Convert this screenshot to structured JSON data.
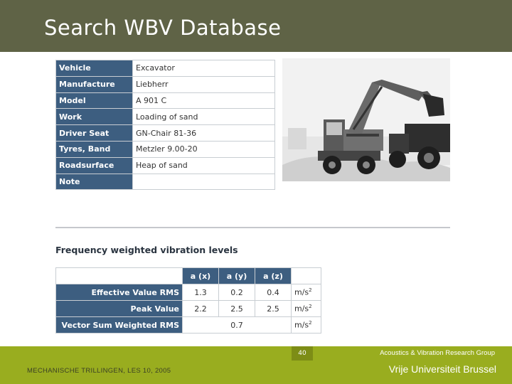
{
  "slide": {
    "title": "Search WBV Database"
  },
  "info_table": {
    "rows": [
      {
        "label": "Vehicle",
        "value": "Excavator"
      },
      {
        "label": "Manufacture",
        "value": "Liebherr"
      },
      {
        "label": "Model",
        "value": "A 901 C"
      },
      {
        "label": "Work",
        "value": "Loading of sand"
      },
      {
        "label": "Driver Seat",
        "value": "GN-Chair 81-36"
      },
      {
        "label": "Tyres, Band",
        "value": "Metzler 9.00-20"
      },
      {
        "label": "Roadsurface",
        "value": "Heap of sand"
      },
      {
        "label": "Note",
        "value": ""
      }
    ]
  },
  "vibration": {
    "heading": "Frequency weighted vibration levels",
    "columns": [
      "a (x)",
      "a (y)",
      "a (z)"
    ],
    "rows": [
      {
        "label": "Effective Value RMS",
        "x": "1.3",
        "y": "0.2",
        "z": "0.4",
        "unit": "m/s",
        "unit_exp": "2"
      },
      {
        "label": "Peak Value",
        "x": "2.2",
        "y": "2.5",
        "z": "2.5",
        "unit": "m/s",
        "unit_exp": "2"
      }
    ],
    "sum_row": {
      "label": "Vector Sum Weighted RMS",
      "value": "0.7",
      "unit": "m/s",
      "unit_exp": "2"
    }
  },
  "footer": {
    "page_number": "40",
    "course": "MECHANISCHE TRILLINGEN, LES 10, 2005",
    "group": "Acoustics & Vibration Research Group",
    "university": "Vrije Universiteit Brussel"
  },
  "icons": {
    "photo": "excavator-photo"
  },
  "colors": {
    "title_bar": "#5f6346",
    "table_header": "#3d5e80",
    "footer": "#99ad1f"
  }
}
